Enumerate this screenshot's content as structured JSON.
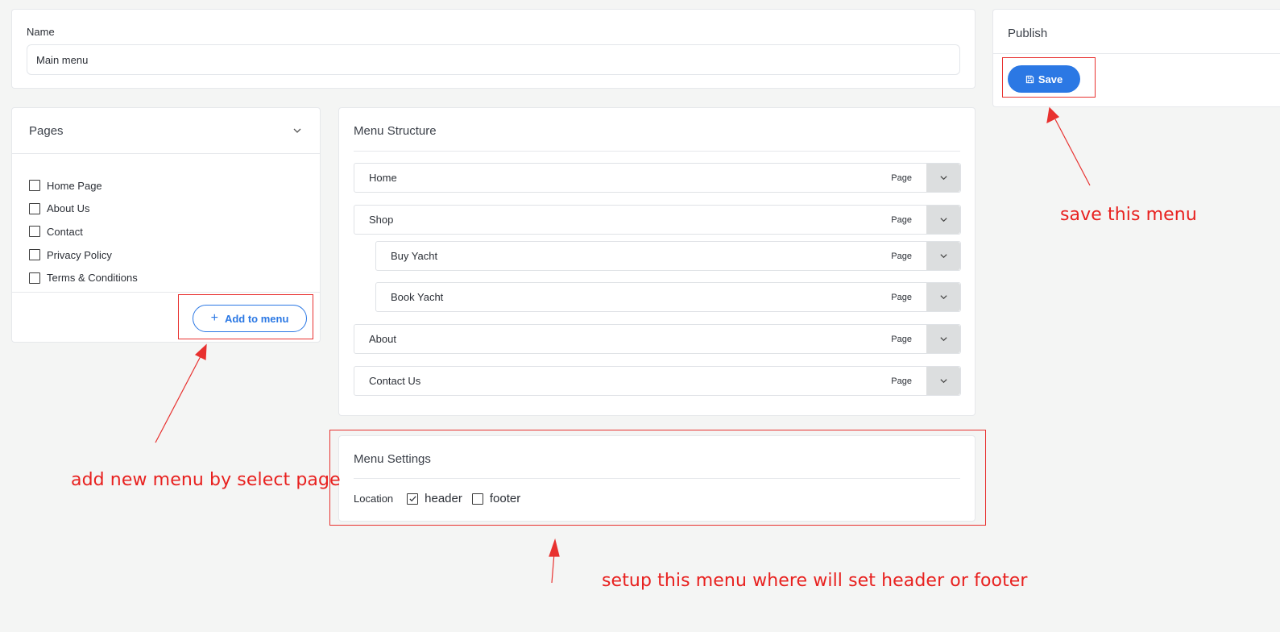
{
  "name_section": {
    "label": "Name",
    "value": "Main menu"
  },
  "publish": {
    "title": "Publish",
    "save_label": "Save",
    "save_icon": "floppy-disk-icon",
    "accent": "#2b78e4"
  },
  "pages_panel": {
    "title": "Pages",
    "toggle_icon": "chevron-down-icon",
    "items": [
      {
        "label": "Home Page",
        "checked": false
      },
      {
        "label": "About Us",
        "checked": false
      },
      {
        "label": "Contact",
        "checked": false
      },
      {
        "label": "Privacy Policy",
        "checked": false
      },
      {
        "label": "Terms & Conditions",
        "checked": false
      }
    ],
    "add_button": "Add to menu",
    "add_icon": "plus-icon"
  },
  "menu_structure": {
    "title": "Menu Structure",
    "items": [
      {
        "label": "Home",
        "type": "Page",
        "level": 0
      },
      {
        "label": "Shop",
        "type": "Page",
        "level": 0
      },
      {
        "label": "Buy Yacht",
        "type": "Page",
        "level": 1
      },
      {
        "label": "Book Yacht",
        "type": "Page",
        "level": 1
      },
      {
        "label": "About",
        "type": "Page",
        "level": 0
      },
      {
        "label": "Contact Us",
        "type": "Page",
        "level": 0
      }
    ]
  },
  "menu_settings": {
    "title": "Menu Settings",
    "location_label": "Location",
    "options": [
      {
        "label": "header",
        "checked": true
      },
      {
        "label": "footer",
        "checked": false
      }
    ]
  },
  "annotations": {
    "save_note": "save this menu",
    "add_note": "add new menu by select page",
    "settings_note": "setup this menu where will set header or footer",
    "color": "#e8312f"
  }
}
